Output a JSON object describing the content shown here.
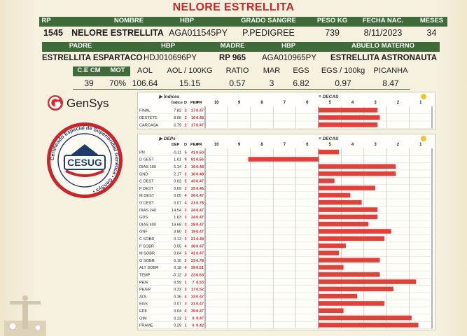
{
  "title": "NELORE ESTRELLITA",
  "animal_header": {
    "labels": [
      "RP",
      "NOMBRE",
      "HBP",
      "GRADO SANGRE",
      "PESO KG",
      "FECHA NAC.",
      "MESES"
    ],
    "values": [
      "1545",
      "NELORE ESTRELLITA",
      "AGA011545PY",
      "P.PEDIGREE",
      "739",
      "8/11/2023",
      "34"
    ]
  },
  "parents_header": {
    "labels": [
      "PADRE",
      "HBP",
      "MADRE",
      "HBP",
      "ABUELO MATERNO"
    ],
    "values": [
      "ESTRELLITA ESPARTACO",
      "HDJ010696PY",
      "RP 965",
      "AGA010965PY",
      "ESTRELLITA ASTRONAUTA"
    ]
  },
  "carcass_header": {
    "labels": [
      "C.E CM",
      "MOT",
      "AOL",
      "AOL / 100KG",
      "RATIO",
      "MAR",
      "EGS",
      "EGS / 100kg",
      "PICANHA"
    ],
    "values": [
      "39",
      "70%",
      "106.64",
      "15.15",
      "0.57",
      "3",
      "6.82",
      "0.97",
      "8.47"
    ]
  },
  "logos": {
    "gensys": "GenSys",
    "seal_text": "CESUG",
    "seal_ring_text": "Certificado Especial de Superioridad Genética • GenSys •"
  },
  "colors": {
    "accent_red": "#c8262a",
    "header_green": "#3f6a3a",
    "bar_red": "#e0413a",
    "background": "#f6f0df"
  },
  "indices_panel": {
    "title": "Índices",
    "decas_title": "DECAS",
    "col_headers": [
      "Índice",
      "D",
      "PER",
      "PR"
    ],
    "deca_scale": [
      "10",
      "9",
      "8",
      "7",
      "6",
      "5",
      "4",
      "3",
      "2",
      "1"
    ],
    "rows": [
      {
        "name": "FINAL",
        "value": "7.82",
        "d": "2",
        "per": "17",
        "pr": "0.47",
        "decas": 2.4
      },
      {
        "name": "DESTETE",
        "value": "8.06",
        "d": "2",
        "per": "19",
        "pr": "0.48",
        "decas": 2.3
      },
      {
        "name": "CARCASA",
        "value": "6.79",
        "d": "2",
        "per": "17",
        "pr": "0.47",
        "decas": 2.4
      }
    ]
  },
  "deps_panel": {
    "title": "DEPs",
    "decas_title": "DECAS",
    "col_headers": [
      "DEP",
      "D",
      "PER",
      "PR"
    ],
    "deca_scale": [
      "10",
      "9",
      "8",
      "7",
      "6",
      "5",
      "4",
      "3",
      "2",
      "1"
    ],
    "rows": [
      {
        "name": "PN",
        "value": "-0.11",
        "d": "5",
        "per": "41",
        "pr": "0.50",
        "decas": 4.1
      },
      {
        "name": "D GEST",
        "value": "1.01",
        "d": "9",
        "per": "81",
        "pr": "0.56",
        "decas": 8.1
      },
      {
        "name": "DIAS 160",
        "value": "5.14",
        "d": "2",
        "per": "16",
        "pr": "0.48",
        "decas": 1.6
      },
      {
        "name": "GND",
        "value": "2.17",
        "d": "2",
        "per": "16",
        "pr": "0.48",
        "decas": 1.6
      },
      {
        "name": "C DEST",
        "value": "0.02",
        "d": "5",
        "per": "43",
        "pr": "0.47",
        "decas": 4.3
      },
      {
        "name": "P DEST",
        "value": "0.09",
        "d": "3",
        "per": "25",
        "pr": "0.46",
        "decas": 2.5
      },
      {
        "name": "M DEST",
        "value": "0.05",
        "d": "4",
        "per": "36",
        "pr": "0.47",
        "decas": 3.6
      },
      {
        "name": "O DEST",
        "value": "0.07",
        "d": "4",
        "per": "31",
        "pr": "0.78",
        "decas": 3.1
      },
      {
        "name": "DIAS 240",
        "value": "14.54",
        "d": "3",
        "per": "24",
        "pr": "0.47",
        "decas": 2.4
      },
      {
        "name": "GDS",
        "value": "1.63",
        "d": "3",
        "per": "24",
        "pr": "0.47",
        "decas": 2.4
      },
      {
        "name": "DIAS 400",
        "value": "19.68",
        "d": "2",
        "per": "28",
        "pr": "0.47",
        "decas": 2.8
      },
      {
        "name": "GNF",
        "value": "3.80",
        "d": "2",
        "per": "18",
        "pr": "0.47",
        "decas": 1.8
      },
      {
        "name": "C SOBR",
        "value": "0.12",
        "d": "3",
        "per": "21",
        "pr": "0.48",
        "decas": 2.1
      },
      {
        "name": "P SOBR",
        "value": "0.05",
        "d": "4",
        "per": "38",
        "pr": "0.47",
        "decas": 3.8
      },
      {
        "name": "M SOBR",
        "value": "0.04",
        "d": "5",
        "per": "41",
        "pr": "0.47",
        "decas": 4.1
      },
      {
        "name": "O SOBR",
        "value": "0.10",
        "d": "3",
        "per": "23",
        "pr": "0.78",
        "decas": 2.3
      },
      {
        "name": "ALT SOBR",
        "value": "0.18",
        "d": "4",
        "per": "39",
        "pr": "0.51",
        "decas": 3.9
      },
      {
        "name": "TEMP",
        "value": "-0.12",
        "d": "3",
        "per": "23",
        "pr": "0.63",
        "decas": 2.3
      },
      {
        "name": "PE/E",
        "value": "0.59",
        "d": "1",
        "per": "7",
        "pr": "0.53",
        "decas": 0.7
      },
      {
        "name": "PE/EP",
        "value": "0.32",
        "d": "2",
        "per": "17",
        "pr": "0.52",
        "decas": 1.7
      },
      {
        "name": "AOL",
        "value": "0.36",
        "d": "4",
        "per": "33",
        "pr": "0.47",
        "decas": 3.3
      },
      {
        "name": "EGS",
        "value": "0.07",
        "d": "3",
        "per": "21",
        "pr": "0.47",
        "decas": 2.1
      },
      {
        "name": "EP8",
        "value": "0.04",
        "d": "4",
        "per": "39",
        "pr": "0.47",
        "decas": 3.9
      },
      {
        "name": "GIM",
        "value": "0.13",
        "d": "1",
        "per": "9",
        "pr": "0.47",
        "decas": 0.9
      },
      {
        "name": "FRAME",
        "value": "0.29",
        "d": "1",
        "per": "6",
        "pr": "0.42",
        "decas": 0.6
      }
    ]
  }
}
